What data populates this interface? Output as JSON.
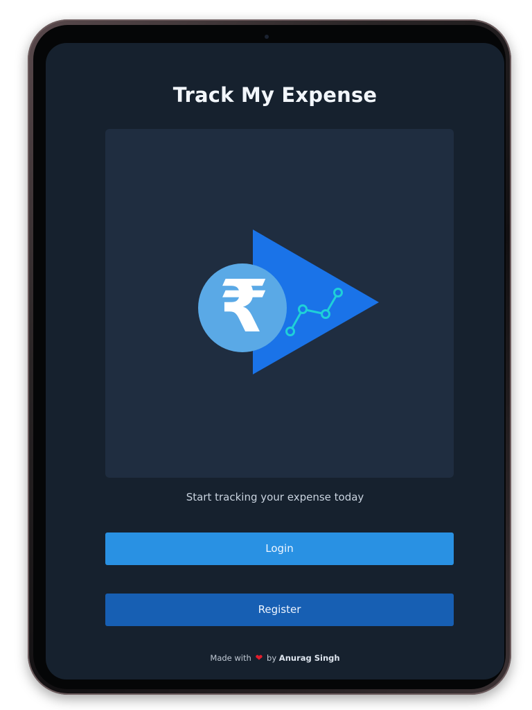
{
  "app": {
    "title": "Track My Expense",
    "tagline": "Start tracking your expense today"
  },
  "hero": {
    "logo_icon": "rupee-chart-play-logo",
    "currency_symbol": "₹"
  },
  "buttons": {
    "login_label": "Login",
    "register_label": "Register"
  },
  "footer": {
    "made_with": "Made with",
    "by": "by",
    "author": "Anurag Singh",
    "heart_icon": "heart-icon"
  },
  "colors": {
    "screen_bg": "#16212e",
    "hero_bg": "#1f2d40",
    "login_button": "#2991e3",
    "register_button": "#175fb3",
    "logo_triangle": "#1a73e8",
    "logo_circle": "#5aa9e6",
    "logo_chart": "#1fd0d8",
    "heart": "#e21d2c"
  }
}
